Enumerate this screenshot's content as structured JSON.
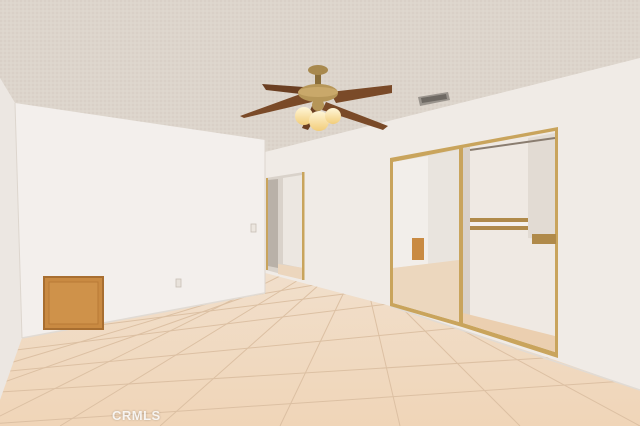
{
  "photo": {
    "subject": "empty-bedroom",
    "watermark_text": "CRMLS"
  },
  "colors": {
    "ceiling": "#ddd5cc",
    "wall_left": "#f2eeeb",
    "wall_back": "#ebe6e1",
    "wall_right": "#f4f0ec",
    "floor_tile": "#efd8bf",
    "grout": "#d9bda0",
    "wood_panel": "#c98a42",
    "brass": "#c9a45c"
  }
}
